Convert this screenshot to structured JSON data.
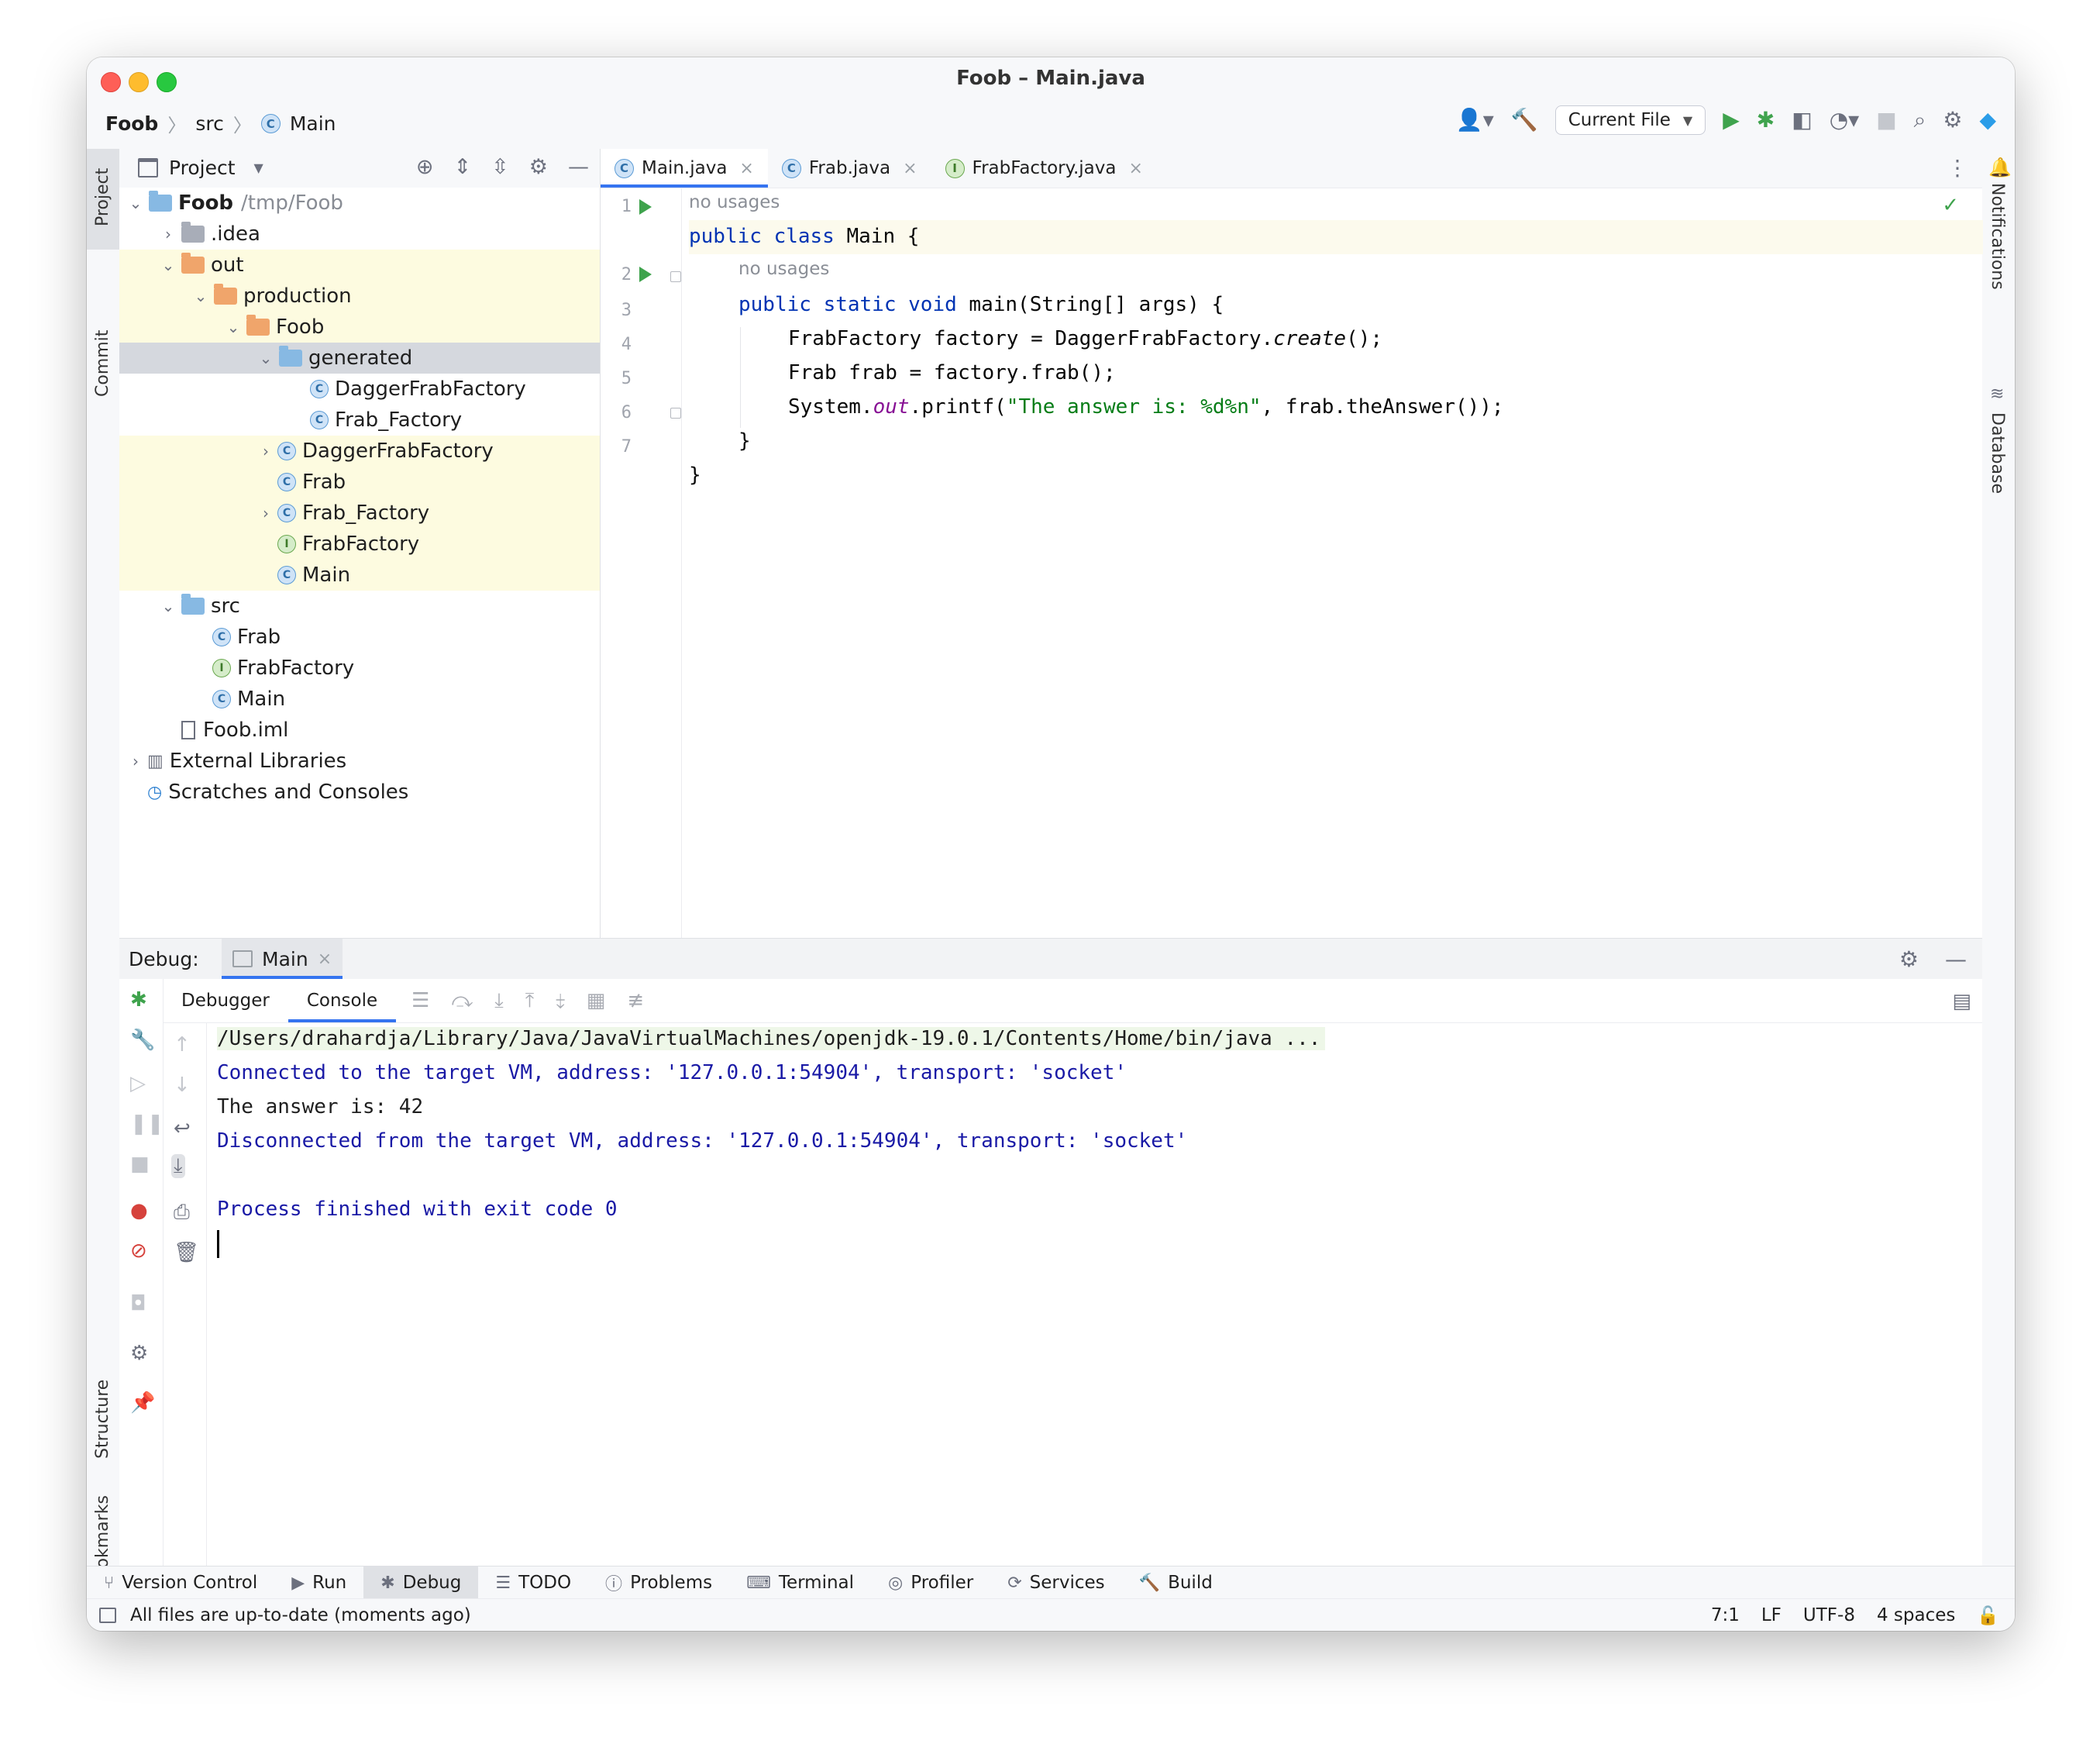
{
  "window": {
    "title": "Foob – Main.java"
  },
  "breadcrumbs": [
    "Foob",
    "src",
    "Main"
  ],
  "toolbar": {
    "run_config": "Current File"
  },
  "left_strip": {
    "project": "Project",
    "commit": "Commit",
    "structure": "Structure",
    "bookmarks": "Bookmarks"
  },
  "right_strip": {
    "notifications": "Notifications",
    "database": "Database"
  },
  "project": {
    "title": "Project",
    "tree": [
      {
        "label": "Foob",
        "extra": "/tmp/Foob",
        "depth": 0,
        "icon": "folder-blue",
        "chev": "v",
        "bold": true
      },
      {
        "label": ".idea",
        "depth": 1,
        "icon": "folder-gray",
        "chev": ">"
      },
      {
        "label": "out",
        "depth": 1,
        "icon": "folder-orange",
        "chev": "v",
        "hl": true
      },
      {
        "label": "production",
        "depth": 2,
        "icon": "folder-orange",
        "chev": "v",
        "hl": true
      },
      {
        "label": "Foob",
        "depth": 3,
        "icon": "folder-orange",
        "chev": "v",
        "hl": true
      },
      {
        "label": "generated",
        "depth": 4,
        "icon": "folder-blue",
        "chev": "v",
        "sel": true
      },
      {
        "label": "DaggerFrabFactory",
        "depth": 5,
        "icon": "class",
        "chev": ""
      },
      {
        "label": "Frab_Factory",
        "depth": 5,
        "icon": "class",
        "chev": ""
      },
      {
        "label": "DaggerFrabFactory",
        "depth": 4,
        "icon": "class",
        "chev": ">",
        "hl": true
      },
      {
        "label": "Frab",
        "depth": 4,
        "icon": "class",
        "chev": "",
        "hl": true
      },
      {
        "label": "Frab_Factory",
        "depth": 4,
        "icon": "class",
        "chev": ">",
        "hl": true
      },
      {
        "label": "FrabFactory",
        "depth": 4,
        "icon": "interface",
        "chev": "",
        "hl": true
      },
      {
        "label": "Main",
        "depth": 4,
        "icon": "class",
        "chev": "",
        "hl": true
      },
      {
        "label": "src",
        "depth": 1,
        "icon": "folder-blue",
        "chev": "v"
      },
      {
        "label": "Frab",
        "depth": 2,
        "icon": "class",
        "chev": ""
      },
      {
        "label": "FrabFactory",
        "depth": 2,
        "icon": "interface",
        "chev": ""
      },
      {
        "label": "Main",
        "depth": 2,
        "icon": "class",
        "chev": ""
      },
      {
        "label": "Foob.iml",
        "depth": 1,
        "icon": "file",
        "chev": ""
      },
      {
        "label": "External Libraries",
        "depth": 0,
        "icon": "libraries",
        "chev": ">"
      },
      {
        "label": "Scratches and Consoles",
        "depth": 0,
        "icon": "scratches",
        "chev": ""
      }
    ]
  },
  "editor": {
    "tabs": [
      {
        "label": "Main.java",
        "icon": "C",
        "active": true
      },
      {
        "label": "Frab.java",
        "icon": "C",
        "active": false
      },
      {
        "label": "FrabFactory.java",
        "icon": "I",
        "active": false
      }
    ],
    "hint_usages": "no usages",
    "lines": {
      "l1_kw": "public class ",
      "l1_rest": "Main {",
      "l2_kw": "public static void ",
      "l2_rest": "main(String[] args) {",
      "l3_a": "FrabFactory factory = DaggerFrabFactory.",
      "l3_it": "create",
      "l3_b": "();",
      "l4": "Frab frab = factory.frab();",
      "l5_a": "System.",
      "l5_fld": "out",
      "l5_b": ".printf(",
      "l5_str": "\"The answer is: %d%n\"",
      "l5_c": ", frab.theAnswer());",
      "l6": "}",
      "l7": "}"
    },
    "line_numbers": [
      "1",
      "2",
      "3",
      "4",
      "5",
      "6",
      "7"
    ]
  },
  "debug": {
    "label": "Debug:",
    "session_tab": "Main",
    "sub_tabs": [
      "Debugger",
      "Console"
    ],
    "console": [
      "/Users/drahardja/Library/Java/JavaVirtualMachines/openjdk-19.0.1/Contents/Home/bin/java ...",
      "Connected to the target VM, address: '127.0.0.1:54904', transport: 'socket'",
      "The answer is: 42",
      "Disconnected from the target VM, address: '127.0.0.1:54904', transport: 'socket'",
      "",
      "Process finished with exit code 0"
    ]
  },
  "bottom_tabs": [
    "Version Control",
    "Run",
    "Debug",
    "TODO",
    "Problems",
    "Terminal",
    "Profiler",
    "Services",
    "Build"
  ],
  "status": {
    "message": "All files are up-to-date (moments ago)",
    "position": "7:1",
    "line_sep": "LF",
    "encoding": "UTF-8",
    "indent": "4 spaces"
  }
}
